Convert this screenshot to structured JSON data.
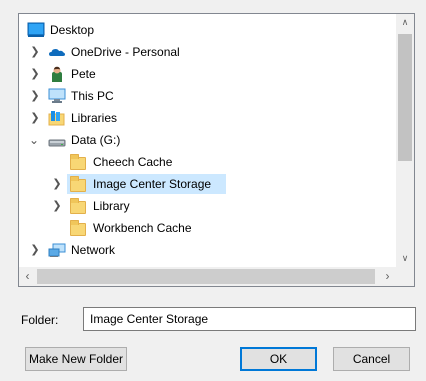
{
  "tree": {
    "items": [
      {
        "label": "Desktop",
        "icon": "desktop-icon",
        "expander": ""
      },
      {
        "label": "OneDrive - Personal",
        "icon": "onedrive-cloud-icon",
        "expander": ">"
      },
      {
        "label": "Pete",
        "icon": "user-icon",
        "expander": ">"
      },
      {
        "label": "This PC",
        "icon": "computer-icon",
        "expander": ">"
      },
      {
        "label": "Libraries",
        "icon": "libraries-icon",
        "expander": ">"
      },
      {
        "label": "Data (G:)",
        "icon": "drive-icon",
        "expander": "v"
      },
      {
        "label": "Cheech Cache",
        "icon": "folder-icon",
        "expander": ""
      },
      {
        "label": "Image Center Storage",
        "icon": "folder-icon",
        "expander": ">"
      },
      {
        "label": "Library",
        "icon": "folder-icon",
        "expander": ">"
      },
      {
        "label": "Workbench Cache",
        "icon": "folder-icon",
        "expander": ""
      },
      {
        "label": "Network",
        "icon": "network-icon",
        "expander": ">"
      }
    ],
    "selected_item": "Image Center Storage"
  },
  "folder_field": {
    "label": "Folder:",
    "value": "Image Center Storage"
  },
  "buttons": {
    "make_new_folder": "Make New Folder",
    "ok": "OK",
    "cancel": "Cancel"
  },
  "colors": {
    "selection": "#cce8ff",
    "default_button_border": "#0078d7",
    "folder_fill": "#f8d775"
  }
}
